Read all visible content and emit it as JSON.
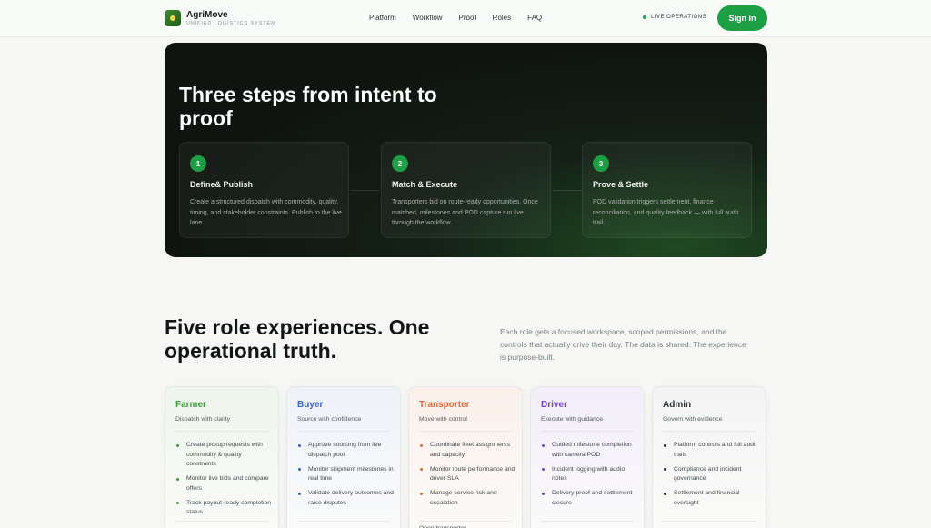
{
  "nav": {
    "brand_name": "AgriMove",
    "brand_sub": "UNIFIED LOGISTICS SYSTEM",
    "links": [
      "Platform",
      "Workflow",
      "Proof",
      "Roles",
      "FAQ"
    ],
    "live_status": "LIVE OPERATIONS",
    "signin_label": "Sign in"
  },
  "hero": {
    "title": "Three steps from intent to proof",
    "steps": [
      {
        "num": "1",
        "title": "Define& Publish",
        "desc": "Create a structured dispatch with commodity, quality, timing, and stakeholder constraints. Publish to the live lane."
      },
      {
        "num": "2",
        "title": "Match & Execute",
        "desc": "Transporters bid on route-ready opportunities. Once matched, milestones and POD capture run live through the workflow."
      },
      {
        "num": "3",
        "title": "Prove & Settle",
        "desc": "POD validation triggers settlement, finance reconciliation, and quality feedback — with full audit trail."
      }
    ]
  },
  "roles": {
    "title": "Five role experiences. One operational truth.",
    "intro": "Each role gets a focused workspace, scoped permissions, and the controls that actually drive their day. The data is shared. The experience is purpose-built.",
    "cards": [
      {
        "name": "Farmer",
        "subtitle": "Dispatch with clarity",
        "color": "#3e9a3a",
        "bg": "#eef5ec",
        "items": [
          "Create pickup requests with commodity & quality constraints",
          "Monitor live bids and compare offers",
          "Track payout-ready completion status"
        ],
        "footer": ""
      },
      {
        "name": "Buyer",
        "subtitle": "Source with confidence",
        "color": "#3f63c4",
        "bg": "#eef2f9",
        "items": [
          "Approve sourcing from live dispatch pool",
          "Monitor shipment milestones in real time",
          "Validate delivery outcomes and raise disputes"
        ],
        "footer": ""
      },
      {
        "name": "Transporter",
        "subtitle": "Move with control",
        "color": "#de6a3a",
        "bg": "#fbf0ea",
        "items": [
          "Coordinate fleet assignments and capacity",
          "Monitor route performance and driver SLA",
          "Manage service risk and escalation"
        ],
        "footer": "Open transporter"
      },
      {
        "name": "Driver",
        "subtitle": "Execute with guidance",
        "color": "#7a44c8",
        "bg": "#f2edf9",
        "items": [
          "Guided milestone completion with camera POD",
          "Incident logging with audio notes",
          "Delivery proof and settlement closure"
        ],
        "footer": ""
      },
      {
        "name": "Admin",
        "subtitle": "Govern with evidence",
        "color": "#2a2f33",
        "bg": "#f3f4f3",
        "items": [
          "Platform controls and full audit trails",
          "Compliance and incident governance",
          "Settlement and financial oversight"
        ],
        "footer": ""
      }
    ]
  }
}
